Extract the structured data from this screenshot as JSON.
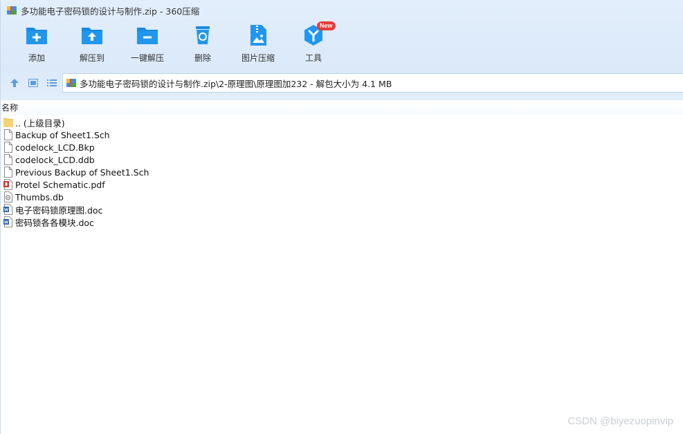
{
  "window": {
    "title": "多功能电子密码锁的设计与制作.zip - 360压缩"
  },
  "toolbar": {
    "items": [
      {
        "label": "添加",
        "icon": "add-folder-icon"
      },
      {
        "label": "解压到",
        "icon": "extract-to-icon"
      },
      {
        "label": "一键解压",
        "icon": "one-click-extract-icon"
      },
      {
        "label": "删除",
        "icon": "recycle-bin-icon"
      },
      {
        "label": "图片压缩",
        "icon": "image-compress-icon"
      },
      {
        "label": "工具",
        "icon": "tools-icon"
      }
    ],
    "new_badge": "New"
  },
  "navigation": {
    "path": "多功能电子密码锁的设计与制作.zip\\2-原理图\\原理图加232 - 解包大小为 4.1 MB"
  },
  "list": {
    "column_name": "名称",
    "files": [
      {
        "name": ".. (上级目录)",
        "type": "folder"
      },
      {
        "name": "Backup of Sheet1.Sch",
        "type": "file"
      },
      {
        "name": "codelock_LCD.Bkp",
        "type": "file"
      },
      {
        "name": "codelock_LCD.ddb",
        "type": "file"
      },
      {
        "name": "Previous Backup of Sheet1.Sch",
        "type": "file"
      },
      {
        "name": "Protel Schematic.pdf",
        "type": "pdf"
      },
      {
        "name": "Thumbs.db",
        "type": "db"
      },
      {
        "name": "电子密码锁原理图.doc",
        "type": "doc"
      },
      {
        "name": "密码锁各各模块.doc",
        "type": "doc"
      }
    ]
  },
  "watermark": "CSDN @biyezuopinvip",
  "colors": {
    "accent_blue": "#1a8be0",
    "toolbar_bg": "#dbe9f9",
    "badge_red": "#e83a34"
  }
}
